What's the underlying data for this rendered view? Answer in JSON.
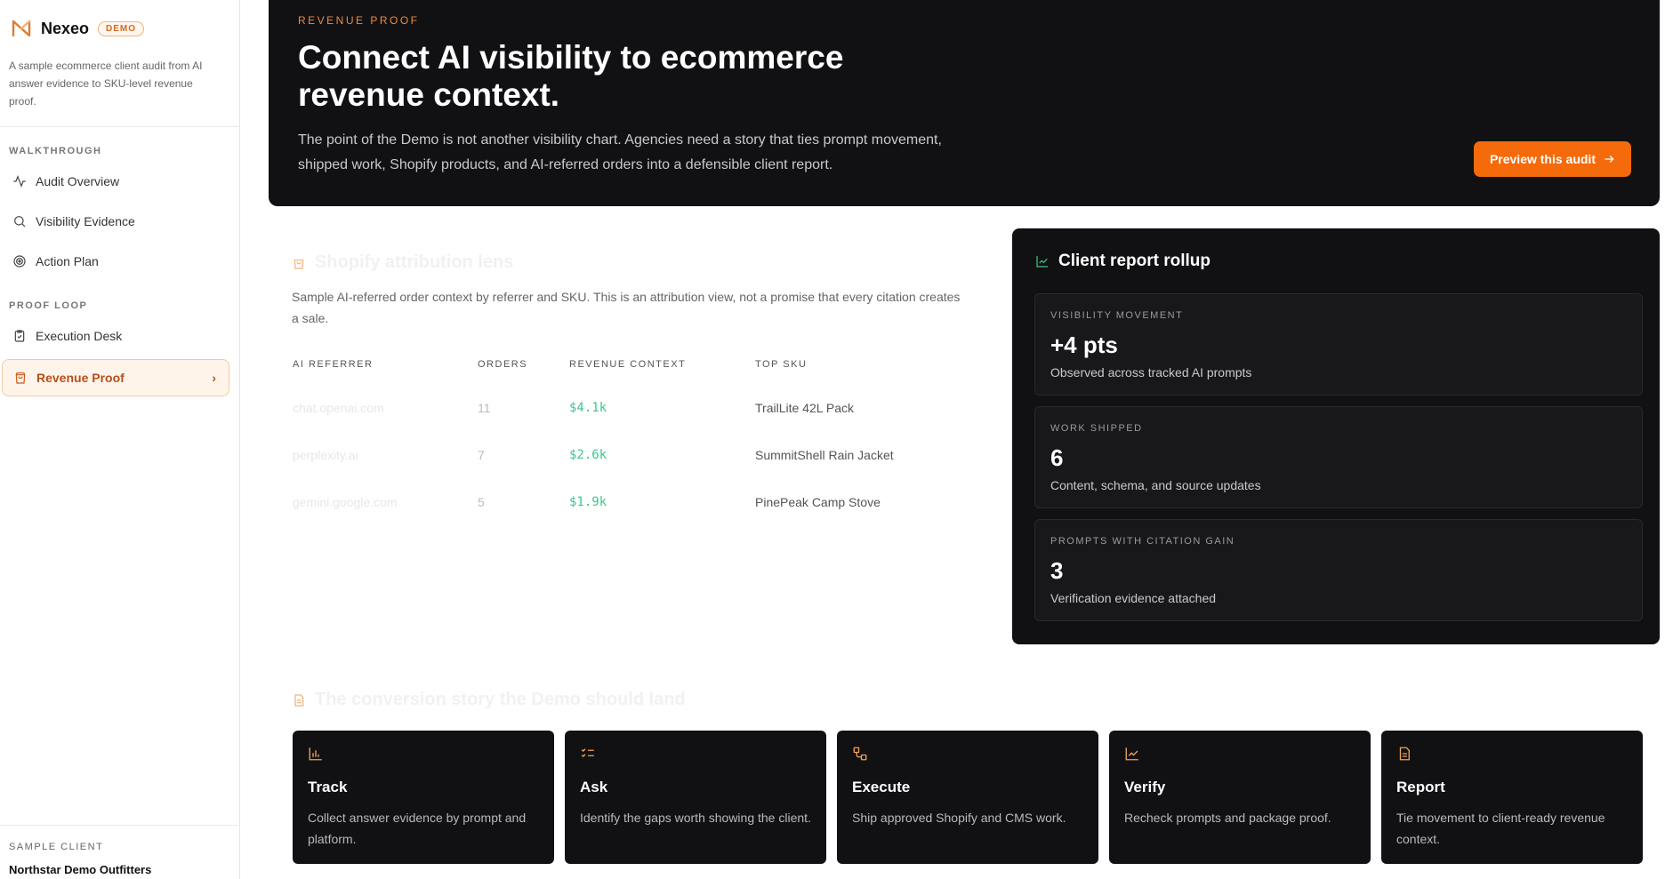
{
  "sidebar": {
    "brand": "Nexeo",
    "badge": "DEMO",
    "description": "A sample ecommerce client audit from AI answer evidence to SKU-level revenue proof.",
    "walkthrough_label": "WALKTHROUGH",
    "walkthrough_items": [
      {
        "label": "Audit Overview",
        "icon": "activity-icon"
      },
      {
        "label": "Visibility Evidence",
        "icon": "search-icon"
      },
      {
        "label": "Action Plan",
        "icon": "target-icon"
      }
    ],
    "proof_label": "PROOF LOOP",
    "proof_items": [
      {
        "label": "Execution Desk",
        "icon": "clipboard-check-icon"
      },
      {
        "label": "Revenue Proof",
        "icon": "shopping-bag-icon",
        "active": true
      }
    ],
    "client_label": "SAMPLE CLIENT",
    "client_name": "Northstar Demo Outfitters"
  },
  "hero": {
    "eyebrow": "REVENUE PROOF",
    "title": "Connect AI visibility to ecommerce revenue context.",
    "description": "The point of the Demo is not another visibility chart. Agencies need a story that ties prompt movement, shipped work, Shopify products, and AI-referred orders into a defensible client report.",
    "button_label": "Preview this audit",
    "button_icon": "arrow-right-icon",
    "accent": "#f56a0a"
  },
  "attribution": {
    "title": "Shopify attribution lens",
    "description": "Sample AI-referred order context by referrer and SKU. This is an attribution view, not a promise that every citation creates a sale.",
    "columns": [
      "AI REFERRER",
      "ORDERS",
      "REVENUE CONTEXT",
      "TOP SKU"
    ],
    "rows": [
      {
        "referrer": "chat.openai.com",
        "orders": "11",
        "revenue": "$4.1k",
        "sku": "TrailLite 42L Pack"
      },
      {
        "referrer": "perplexity.ai",
        "orders": "7",
        "revenue": "$2.6k",
        "sku": "SummitShell Rain Jacket"
      },
      {
        "referrer": "gemini.google.com",
        "orders": "5",
        "revenue": "$1.9k",
        "sku": "PinePeak Camp Stove"
      }
    ]
  },
  "rollup": {
    "title": "Client report rollup",
    "metrics": [
      {
        "label": "VISIBILITY MOVEMENT",
        "value": "+4 pts",
        "note": "Observed across tracked AI prompts"
      },
      {
        "label": "WORK SHIPPED",
        "value": "6",
        "note": "Content, schema, and source updates"
      },
      {
        "label": "PROMPTS WITH CITATION GAIN",
        "value": "3",
        "note": "Verification evidence attached"
      }
    ]
  },
  "conversion": {
    "title": "The conversion story the Demo should land",
    "steps": [
      {
        "title": "Track",
        "description": "Collect answer evidence by prompt and platform.",
        "icon": "bar-chart-icon"
      },
      {
        "title": "Ask",
        "description": "Identify the gaps worth showing the client.",
        "icon": "list-checks-icon"
      },
      {
        "title": "Execute",
        "description": "Ship approved Shopify and CMS work.",
        "icon": "workflow-icon"
      },
      {
        "title": "Verify",
        "description": "Recheck prompts and package proof.",
        "icon": "line-chart-icon"
      },
      {
        "title": "Report",
        "description": "Tie movement to client-ready revenue context.",
        "icon": "file-text-icon"
      }
    ]
  }
}
